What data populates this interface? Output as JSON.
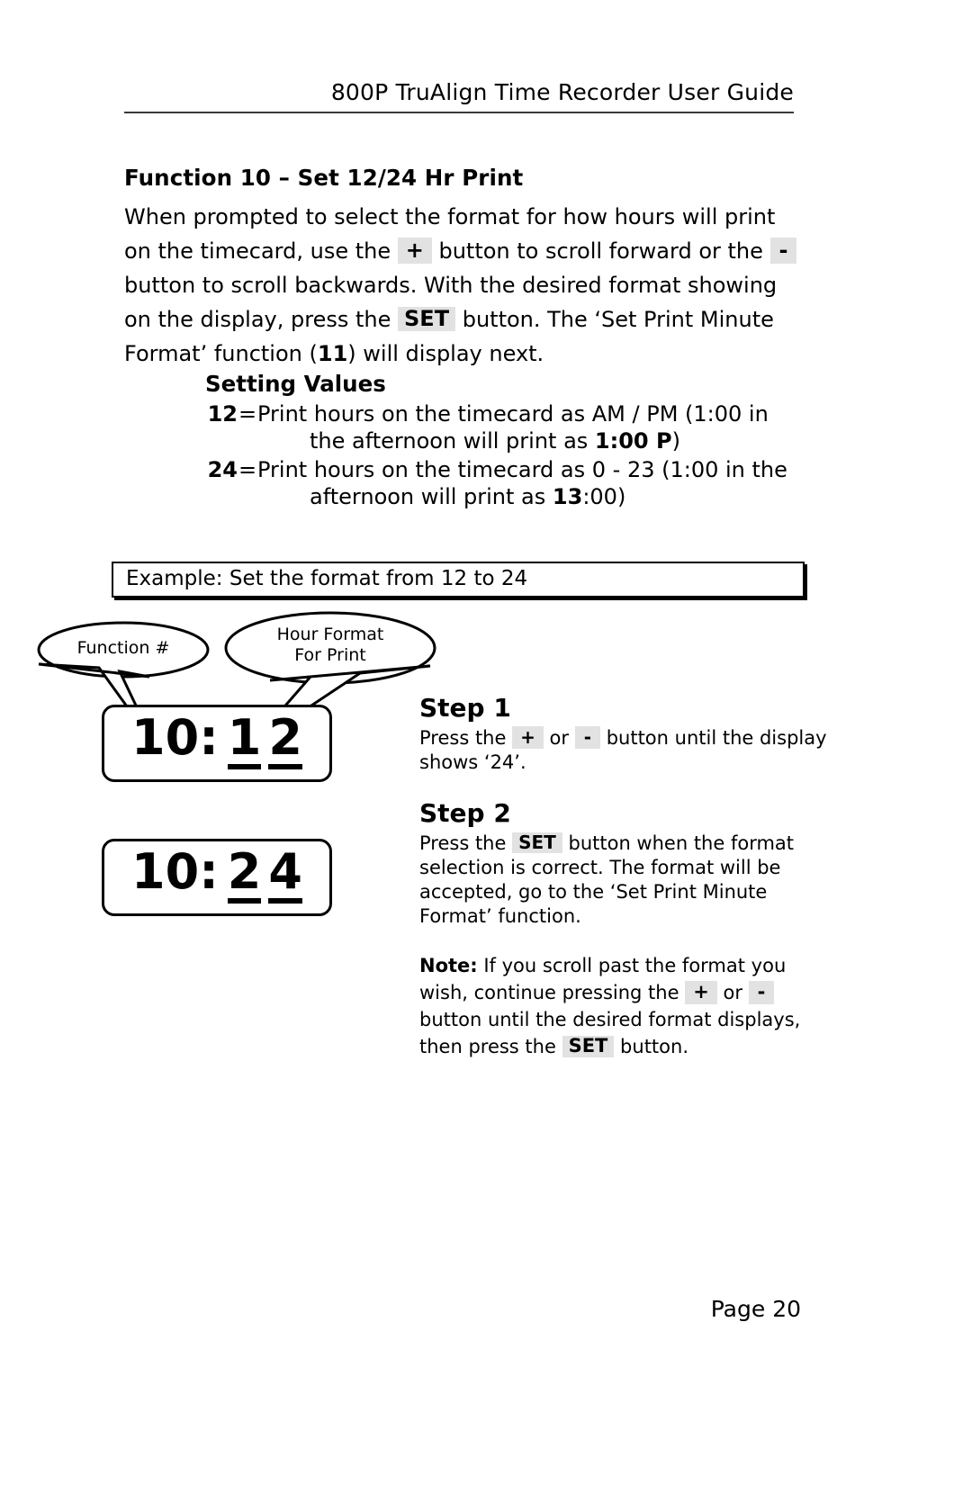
{
  "header": {
    "title": "800P TruAlign Time Recorder User Guide"
  },
  "section": {
    "title": "Function 10 – Set 12/24 Hr Print",
    "intro": {
      "p1": "When prompted to select the format for how hours will print on the timecard, use the ",
      "key_plus": "+",
      "p2": " button to scroll forward or the ",
      "key_minus": "-",
      "p3": " button to scroll backwards. With the desired format showing on the display, press the ",
      "key_set": "SET",
      "p4": " button. The ‘Set Print Minute Format’ function (",
      "fn_number": "11",
      "p5": ") will display next."
    }
  },
  "setting_values": {
    "title": "Setting Values",
    "rows": [
      {
        "key": "12",
        "eq": "=",
        "line1": "Print hours on the timecard as AM / PM (1:00 in",
        "line2_pre": "the afternoon will print as ",
        "line2_bold": "1:00 P",
        "line2_post": ")"
      },
      {
        "key": "24",
        "eq": "=",
        "line1": "Print hours on the timecard as 0 - 23 (1:00 in the",
        "line2_pre": "afternoon will print as ",
        "line2_bold": "13",
        "line2_post": ":00)"
      }
    ]
  },
  "example": {
    "label": "Example: Set the format from 12 to 24"
  },
  "callouts": [
    {
      "name": "function-number",
      "text": "Function #"
    },
    {
      "name": "hour-format-for-print",
      "text": "Hour Format\nFor Print"
    }
  ],
  "displays": [
    {
      "prefix": "10:",
      "digit1": "1",
      "digit2": "2"
    },
    {
      "prefix": "10:",
      "digit1": "2",
      "digit2": "4"
    }
  ],
  "steps": [
    {
      "heading": "Step 1",
      "b1": "Press the ",
      "key_plus": "+",
      "b2": " or ",
      "key_minus": "-",
      "b3": " button until the display shows ‘24’."
    },
    {
      "heading": "Step 2",
      "b1": "Press the ",
      "key_set": "SET",
      "b2": " button when the format selection is correct. The format will be accepted, go to the ‘Set Print Minute Format’ function."
    }
  ],
  "note": {
    "label": "Note:",
    "n1": " If you scroll past the format you wish, continue pressing the ",
    "key_plus": "+",
    "n2": " or ",
    "key_minus": "-",
    "n3": " button until the desired format displays, then press the ",
    "key_set": "SET",
    "n4": " button."
  },
  "footer": {
    "page": "Page 20"
  },
  "colors": {
    "key_background": "#e2e2e2",
    "rule": "#3a3a3a",
    "ink": "#000000",
    "paper": "#ffffff"
  }
}
